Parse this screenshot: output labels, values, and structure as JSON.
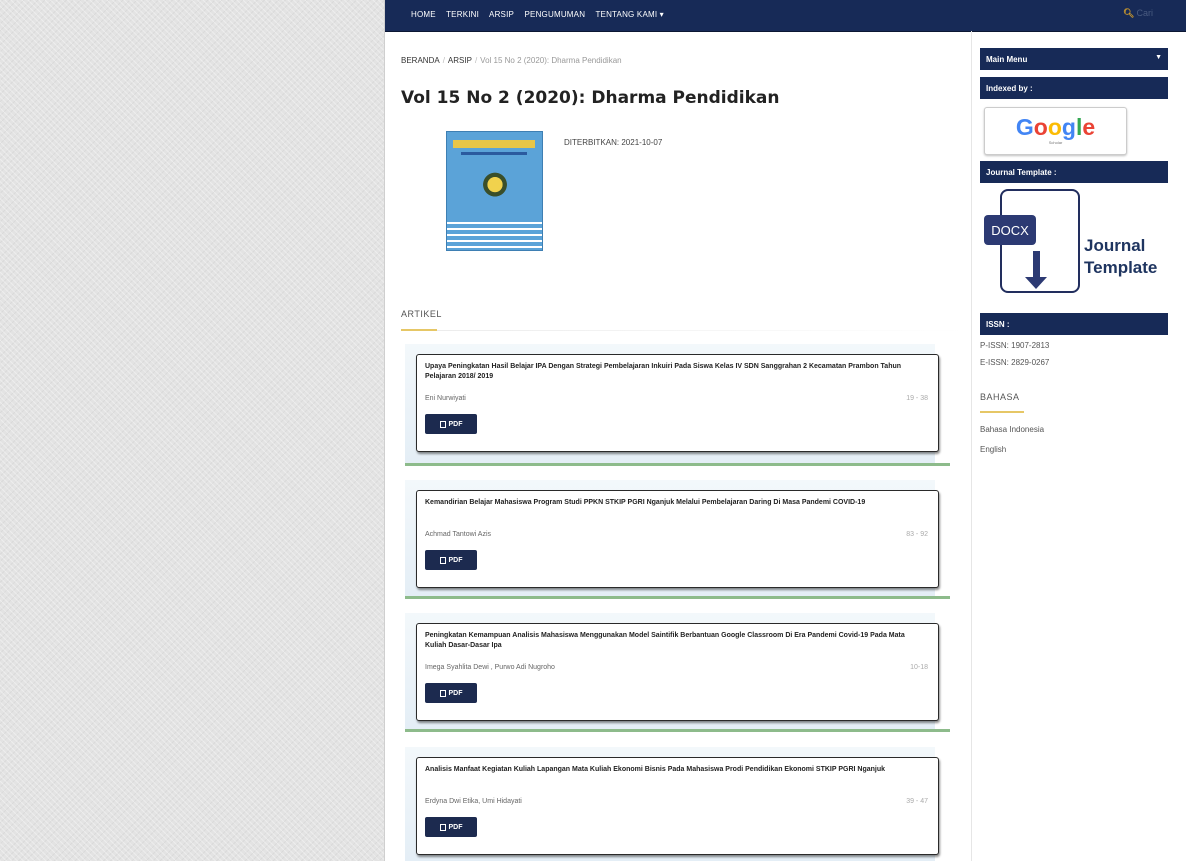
{
  "nav": {
    "items": [
      "HOME",
      "TERKINI",
      "ARSIP",
      "PENGUMUMAN",
      "TENTANG KAMI ▾"
    ],
    "search_label": "Cari"
  },
  "breadcrumb": {
    "home": "BERANDA",
    "archive": "ARSIP",
    "current": "Vol 15 No 2 (2020): Dharma Pendidikan"
  },
  "issue": {
    "title": "Vol 15 No 2 (2020): Dharma Pendidikan",
    "published_label": "DITERBITKAN:",
    "published_date": "2021-10-07"
  },
  "articles_heading": "ARTIKEL",
  "articles": [
    {
      "title": "Upaya Peningkatan Hasil Belajar IPA Dengan Strategi Pembelajaran Inkuiri Pada Siswa Kelas IV SDN Sanggrahan 2 Kecamatan Prambon Tahun Pelajaran 2018/ 2019",
      "authors": "Eni Nurwiyati",
      "pages": "19 - 38",
      "pdf_label": "PDF"
    },
    {
      "title": "Kemandirian Belajar Mahasiswa Program Studi PPKN STKIP PGRI Nganjuk Melalui Pembelajaran Daring Di Masa Pandemi COVID-19",
      "authors": "Achmad Tantowi Azis",
      "pages": "83 - 92",
      "pdf_label": "PDF"
    },
    {
      "title": "Peningkatan Kemampuan Analisis Mahasiswa Menggunakan Model Saintifik Berbantuan Google Classroom Di Era Pandemi Covid-19 Pada Mata Kuliah Dasar-Dasar Ipa",
      "authors": "Imega Syahlita Dewi , Purwo Adi Nugroho",
      "pages": "10-18",
      "pdf_label": "PDF"
    },
    {
      "title": "Analisis Manfaat Kegiatan Kuliah Lapangan Mata Kuliah Ekonomi Bisnis Pada Mahasiswa Prodi Pendidikan Ekonomi STKIP PGRI Nganjuk",
      "authors": "Erdyna Dwi Etika, Umi Hidayati",
      "pages": "39 - 47",
      "pdf_label": "PDF"
    }
  ],
  "sidebar": {
    "main_menu": "Main Menu",
    "indexed_by": "Indexed by :",
    "google_brand": "Google",
    "google_sub": "Scholar",
    "journal_template_heading": "Journal Template :",
    "docx_label": "DOCX",
    "template_label_line1": "Journal",
    "template_label_line2": "Template",
    "issn_heading": "ISSN :",
    "p_issn": "P-ISSN: 1907-2813",
    "e_issn": "E-ISSN: 2829-0267",
    "language_heading": "BAHASA",
    "languages": [
      "Bahasa Indonesia",
      "English"
    ]
  },
  "colors": {
    "navy": "#172a57",
    "accent_gold": "#e6c766",
    "green_divider": "#8dbb8b"
  }
}
